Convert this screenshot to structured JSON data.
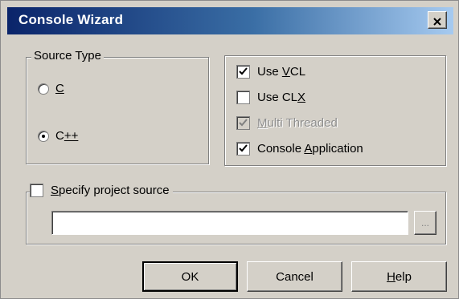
{
  "window": {
    "title": "Console Wizard",
    "close_label": "Close"
  },
  "source_type": {
    "legend": "Source Type",
    "options": [
      {
        "pre": "",
        "mnemonic": "C",
        "post": "",
        "checked": false
      },
      {
        "pre": "C",
        "mnemonic": "++",
        "post": "",
        "checked": true
      }
    ]
  },
  "options": {
    "use_vcl": {
      "pre": "Use ",
      "mnemonic": "V",
      "post": "CL",
      "checked": true,
      "enabled": true
    },
    "use_clx": {
      "pre": "Use CL",
      "mnemonic": "X",
      "post": "",
      "checked": false,
      "enabled": true
    },
    "multi_threaded": {
      "pre": "",
      "mnemonic": "M",
      "post": "ulti Threaded",
      "checked": true,
      "enabled": false
    },
    "console_app": {
      "pre": "Console ",
      "mnemonic": "A",
      "post": "pplication",
      "checked": true,
      "enabled": true
    }
  },
  "project_source": {
    "pre": "",
    "mnemonic": "S",
    "post": "pecify project source",
    "checked": false,
    "value": "",
    "browse_label": "..."
  },
  "buttons": {
    "ok": "OK",
    "cancel": "Cancel",
    "help_mnemonic": "H",
    "help_rest": "elp"
  },
  "colors": {
    "face": "#d4d0c8",
    "title_start": "#0a246a",
    "title_end": "#a6caf0"
  }
}
